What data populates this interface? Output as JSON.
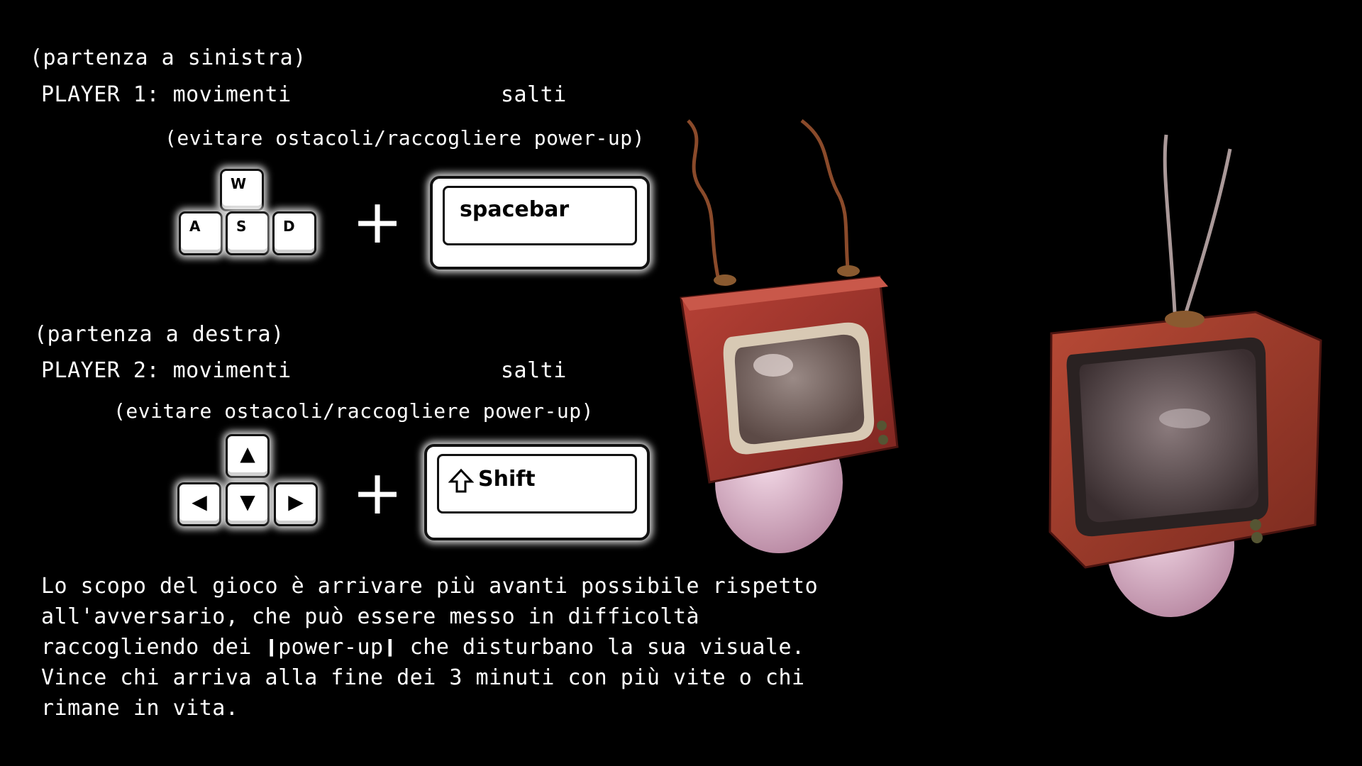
{
  "player1": {
    "start": "(partenza a sinistra)",
    "title": "PLAYER 1: movimenti",
    "jump": "salti",
    "hint": "(evitare ostacoli/raccogliere power-up)",
    "keys": [
      "W",
      "A",
      "S",
      "D"
    ],
    "action_key": "spacebar"
  },
  "player2": {
    "start": "(partenza a destra)",
    "title": "PLAYER 2: movimenti",
    "jump": "salti",
    "hint": "(evitare ostacoli/raccogliere power-up)",
    "keys": [
      "▲",
      "◀",
      "▼",
      "▶"
    ],
    "action_key": "Shift"
  },
  "plus": "+",
  "description": [
    "Lo scopo del gioco è arrivare più avanti possibile rispetto",
    "all'avversario, che può essere messo in difficoltà",
    "raccogliendo dei ❙power-up❙ che disturbano la sua visuale.",
    "Vince chi arriva alla fine dei 3 minuti con più vite o chi",
    "rimane in vita."
  ],
  "colors": {
    "background": "#000000",
    "text": "#ffffff",
    "tv_wood": "#a3312a",
    "tv_screen": "#7d6a66",
    "body_pink": "#e8c4d8"
  },
  "icons": {
    "shift": "up-arrow-outline-icon"
  }
}
